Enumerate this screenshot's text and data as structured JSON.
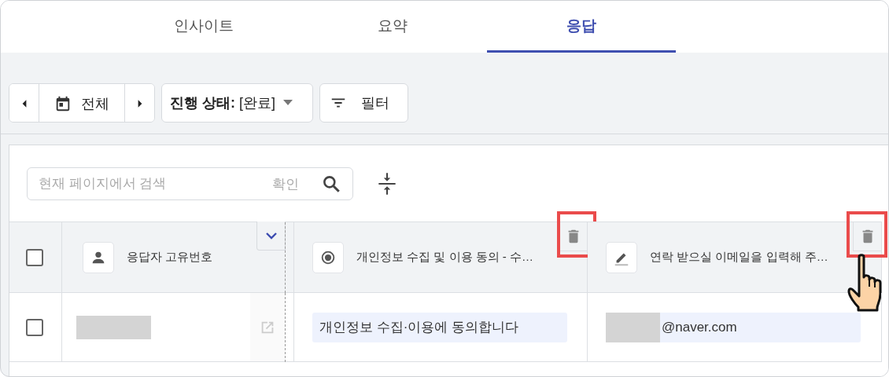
{
  "tabs": [
    {
      "label": "인사이트",
      "selected": false
    },
    {
      "label": "요약",
      "selected": false
    },
    {
      "label": "응답",
      "selected": true
    }
  ],
  "toolbar": {
    "date_range": {
      "label": "전체"
    },
    "status_filter": {
      "label": "**진행 상태:** [완료]"
    },
    "filter_button": {
      "label": "필터"
    }
  },
  "search": {
    "placeholder": "현재 페이지에서 검색",
    "confirm": "확인"
  },
  "table": {
    "select_all": {
      "checked": false
    },
    "columns": [
      {
        "kind": "respondent",
        "title": "응답자 고유번호"
      },
      {
        "kind": "choice",
        "title": "개인정보 수집 및 이용 동의 - 수…",
        "highlighted": true
      },
      {
        "kind": "text",
        "title": "연락 받으실 이메일을 입력해 주…",
        "highlighted": true,
        "pointer": true
      }
    ],
    "rows": [
      {
        "checked": false,
        "cells": [
          {
            "redacted": true
          },
          {
            "value": "개인정보 수집·이용에 동의합니다"
          },
          {
            "redacted": true,
            "value": "@naver.com"
          }
        ]
      }
    ]
  }
}
